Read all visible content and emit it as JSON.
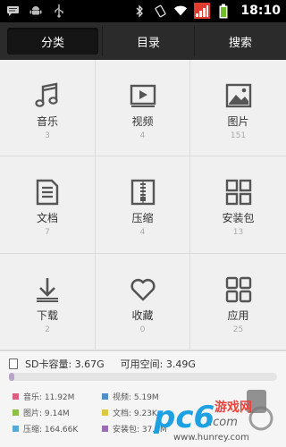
{
  "statusbar": {
    "time": "18:10",
    "icons": [
      "message-icon",
      "android-icon",
      "usb-icon",
      "bluetooth-icon",
      "rotation-icon",
      "wifi-icon",
      "signal-icon",
      "battery-icon"
    ]
  },
  "tabs": [
    {
      "label": "分类",
      "active": true
    },
    {
      "label": "目录",
      "active": false
    },
    {
      "label": "搜索",
      "active": false
    }
  ],
  "categories": [
    {
      "label": "音乐",
      "count": "3",
      "icon": "music-icon"
    },
    {
      "label": "视频",
      "count": "4",
      "icon": "video-icon"
    },
    {
      "label": "图片",
      "count": "151",
      "icon": "image-icon"
    },
    {
      "label": "文档",
      "count": "7",
      "icon": "document-icon"
    },
    {
      "label": "压缩",
      "count": "4",
      "icon": "archive-icon"
    },
    {
      "label": "安装包",
      "count": "13",
      "icon": "package-icon"
    },
    {
      "label": "下载",
      "count": "2",
      "icon": "download-icon"
    },
    {
      "label": "收藏",
      "count": "0",
      "icon": "favorite-icon"
    },
    {
      "label": "应用",
      "count": "25",
      "icon": "apps-icon"
    }
  ],
  "storage": {
    "capacity_label": "SD卡容量: 3.67G",
    "free_label": "可用空间: 3.49G",
    "used_fraction": 0.02,
    "legend": [
      {
        "label": "音乐: 11.92M",
        "color": "#d9607e"
      },
      {
        "label": "视频: 5.19M",
        "color": "#4f8ec9"
      },
      {
        "label": "",
        "color": ""
      },
      {
        "label": "图片: 9.14M",
        "color": "#8ac045"
      },
      {
        "label": "文档: 9.23K",
        "color": "#e0c940"
      },
      {
        "label": "",
        "color": ""
      },
      {
        "label": "压缩: 164.66K",
        "color": "#5aa8d6"
      },
      {
        "label": "安装包: 37.6M",
        "color": "#9b6bb8"
      },
      {
        "label": "",
        "color": ""
      }
    ]
  },
  "colors": {
    "accent_red": "#e33b2e",
    "tab_bg": "#2b2b2b",
    "grid_bg": "#f0f0f0"
  }
}
